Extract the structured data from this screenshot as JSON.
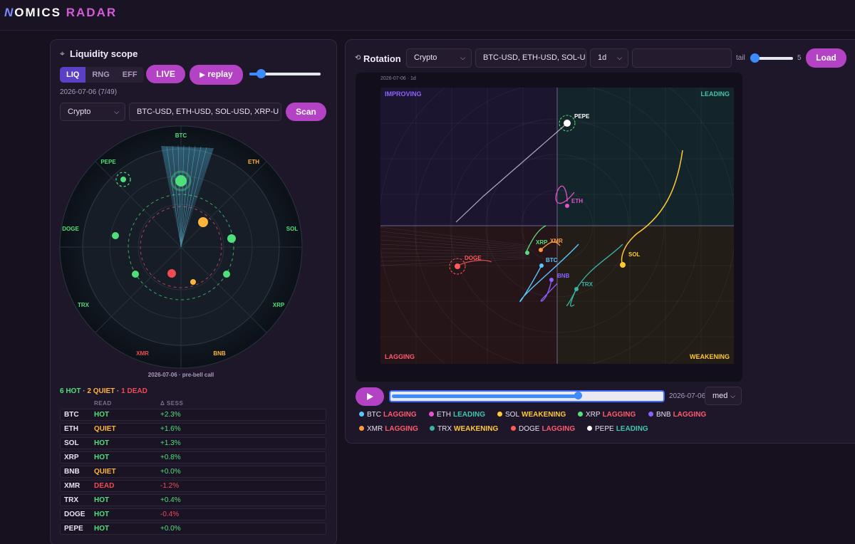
{
  "app": {
    "logo_mark": "N",
    "logo_word1": "OMICS",
    "logo_word2": "RADAR"
  },
  "scope": {
    "title": "Liquidity scope",
    "tabs": [
      "LIQ",
      "RNG",
      "EFF"
    ],
    "live_label": "LIVE",
    "replay_label": "replay",
    "frame_label": "2026-07-06 (7/49)",
    "asset_class": "Crypto",
    "symbols_value": "BTC-USD, ETH-USD, SOL-USD, XRP-U",
    "scan_label": "Scan",
    "radar_caption": "2026-07-06 · pre-bell call",
    "summary": {
      "hot": "6 HOT",
      "quiet": "2 QUIET",
      "dead": "1 DEAD",
      "sep": "·"
    },
    "columns": {
      "read": "READ",
      "delta": "Δ SESS"
    },
    "rows": [
      {
        "sym": "BTC",
        "read": "HOT",
        "delta": "+2.3%"
      },
      {
        "sym": "ETH",
        "read": "QUIET",
        "delta": "+1.6%"
      },
      {
        "sym": "SOL",
        "read": "HOT",
        "delta": "+1.3%"
      },
      {
        "sym": "XRP",
        "read": "HOT",
        "delta": "+0.8%"
      },
      {
        "sym": "BNB",
        "read": "QUIET",
        "delta": "+0.0%"
      },
      {
        "sym": "XMR",
        "read": "DEAD",
        "delta": "-1.2%"
      },
      {
        "sym": "TRX",
        "read": "HOT",
        "delta": "+0.4%"
      },
      {
        "sym": "DOGE",
        "read": "HOT",
        "delta": "-0.4%"
      },
      {
        "sym": "PEPE",
        "read": "HOT",
        "delta": "+0.0%"
      }
    ],
    "radar_labels": [
      "BTC",
      "ETH",
      "SOL",
      "XRP",
      "BNB",
      "XMR",
      "TRX",
      "DOGE",
      "PEPE"
    ]
  },
  "rotation": {
    "title": "Rotation",
    "asset_class": "Crypto",
    "symbols_value": "BTC-USD, ETH-USD, SOL-U",
    "interval": "1d",
    "tail_label": "tail",
    "tail_value": "5",
    "load_label": "Load",
    "chart_caption": "2026-07-06 · 1d",
    "quadrants": {
      "tl": "IMPROVING",
      "tr": "LEADING",
      "bl": "LAGGING",
      "br": "WEAKENING"
    },
    "timeline_date": "2026-07-06",
    "timeline_progress": 0.69,
    "speed": "med",
    "labels": [
      "PEPE",
      "ETH",
      "XRP",
      "XMR",
      "DOGE",
      "BTC",
      "BNB",
      "TRX",
      "SOL"
    ],
    "legend": [
      {
        "sym": "BTC",
        "state": "LAGGING",
        "color": "#57c6ff",
        "scolor": "#ff5a6e"
      },
      {
        "sym": "ETH",
        "state": "LEADING",
        "color": "#e84fd0",
        "scolor": "#3fc6b0"
      },
      {
        "sym": "SOL",
        "state": "WEAKENING",
        "color": "#ffc933",
        "scolor": "#ffc933"
      },
      {
        "sym": "XRP",
        "state": "LAGGING",
        "color": "#57e07a",
        "scolor": "#ff5a6e"
      },
      {
        "sym": "BNB",
        "state": "LAGGING",
        "color": "#8a63ff",
        "scolor": "#ff5a6e"
      },
      {
        "sym": "XMR",
        "state": "LAGGING",
        "color": "#ff9a3c",
        "scolor": "#ff5a6e"
      },
      {
        "sym": "TRX",
        "state": "WEAKENING",
        "color": "#3bb3a4",
        "scolor": "#ffc933"
      },
      {
        "sym": "DOGE",
        "state": "LAGGING",
        "color": "#ff5a5a",
        "scolor": "#ff5a6e"
      },
      {
        "sym": "PEPE",
        "state": "LEADING",
        "color": "#ffffff",
        "scolor": "#3fc6b0"
      }
    ]
  }
}
